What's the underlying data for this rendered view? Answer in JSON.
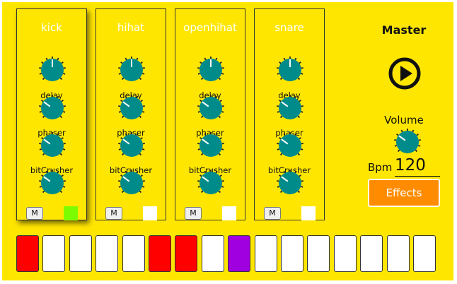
{
  "channels": [
    {
      "name": "kick",
      "selected": true,
      "solo_color": "#7CFC00",
      "knobs": [
        {
          "label": "delay",
          "value": 0.5
        },
        {
          "label": "phaser",
          "value": 0.3
        },
        {
          "label": "bitCrusher",
          "value": 0.3
        },
        {
          "label": "",
          "value": 0.3
        }
      ]
    },
    {
      "name": "hihat",
      "selected": false,
      "solo_color": "#ffffff",
      "knobs": [
        {
          "label": "delay",
          "value": 0.5
        },
        {
          "label": "phaser",
          "value": 0.3
        },
        {
          "label": "bitCrusher",
          "value": 0.3
        },
        {
          "label": "",
          "value": 0.3
        }
      ]
    },
    {
      "name": "openhihat",
      "selected": false,
      "solo_color": "#ffffff",
      "knobs": [
        {
          "label": "delay",
          "value": 0.5
        },
        {
          "label": "phaser",
          "value": 0.3
        },
        {
          "label": "bitCrusher",
          "value": 0.3
        },
        {
          "label": "",
          "value": 0.3
        }
      ]
    },
    {
      "name": "snare",
      "selected": false,
      "solo_color": "#ffffff",
      "knobs": [
        {
          "label": "delay",
          "value": 0.5
        },
        {
          "label": "phaser",
          "value": 0.3
        },
        {
          "label": "bitCrusher",
          "value": 0.3
        },
        {
          "label": "",
          "value": 0.3
        }
      ]
    }
  ],
  "mute_label": "M",
  "master": {
    "title": "Master",
    "play_icon": "play-circle-icon",
    "volume_label": "Volume",
    "volume_value": 0.3,
    "bpm_label": "Bpm",
    "bpm_value": "120",
    "effects_label": "Effects"
  },
  "steps": [
    "red",
    "white",
    "white",
    "white",
    "white",
    "red",
    "red",
    "white",
    "purple",
    "white",
    "white",
    "white",
    "white",
    "white",
    "white",
    "white"
  ],
  "colors": {
    "background": "#FFE600",
    "knob": "#008B8B",
    "step_red": "#FF0000",
    "step_purple": "#A000E0",
    "effects": "#FF8C00"
  }
}
